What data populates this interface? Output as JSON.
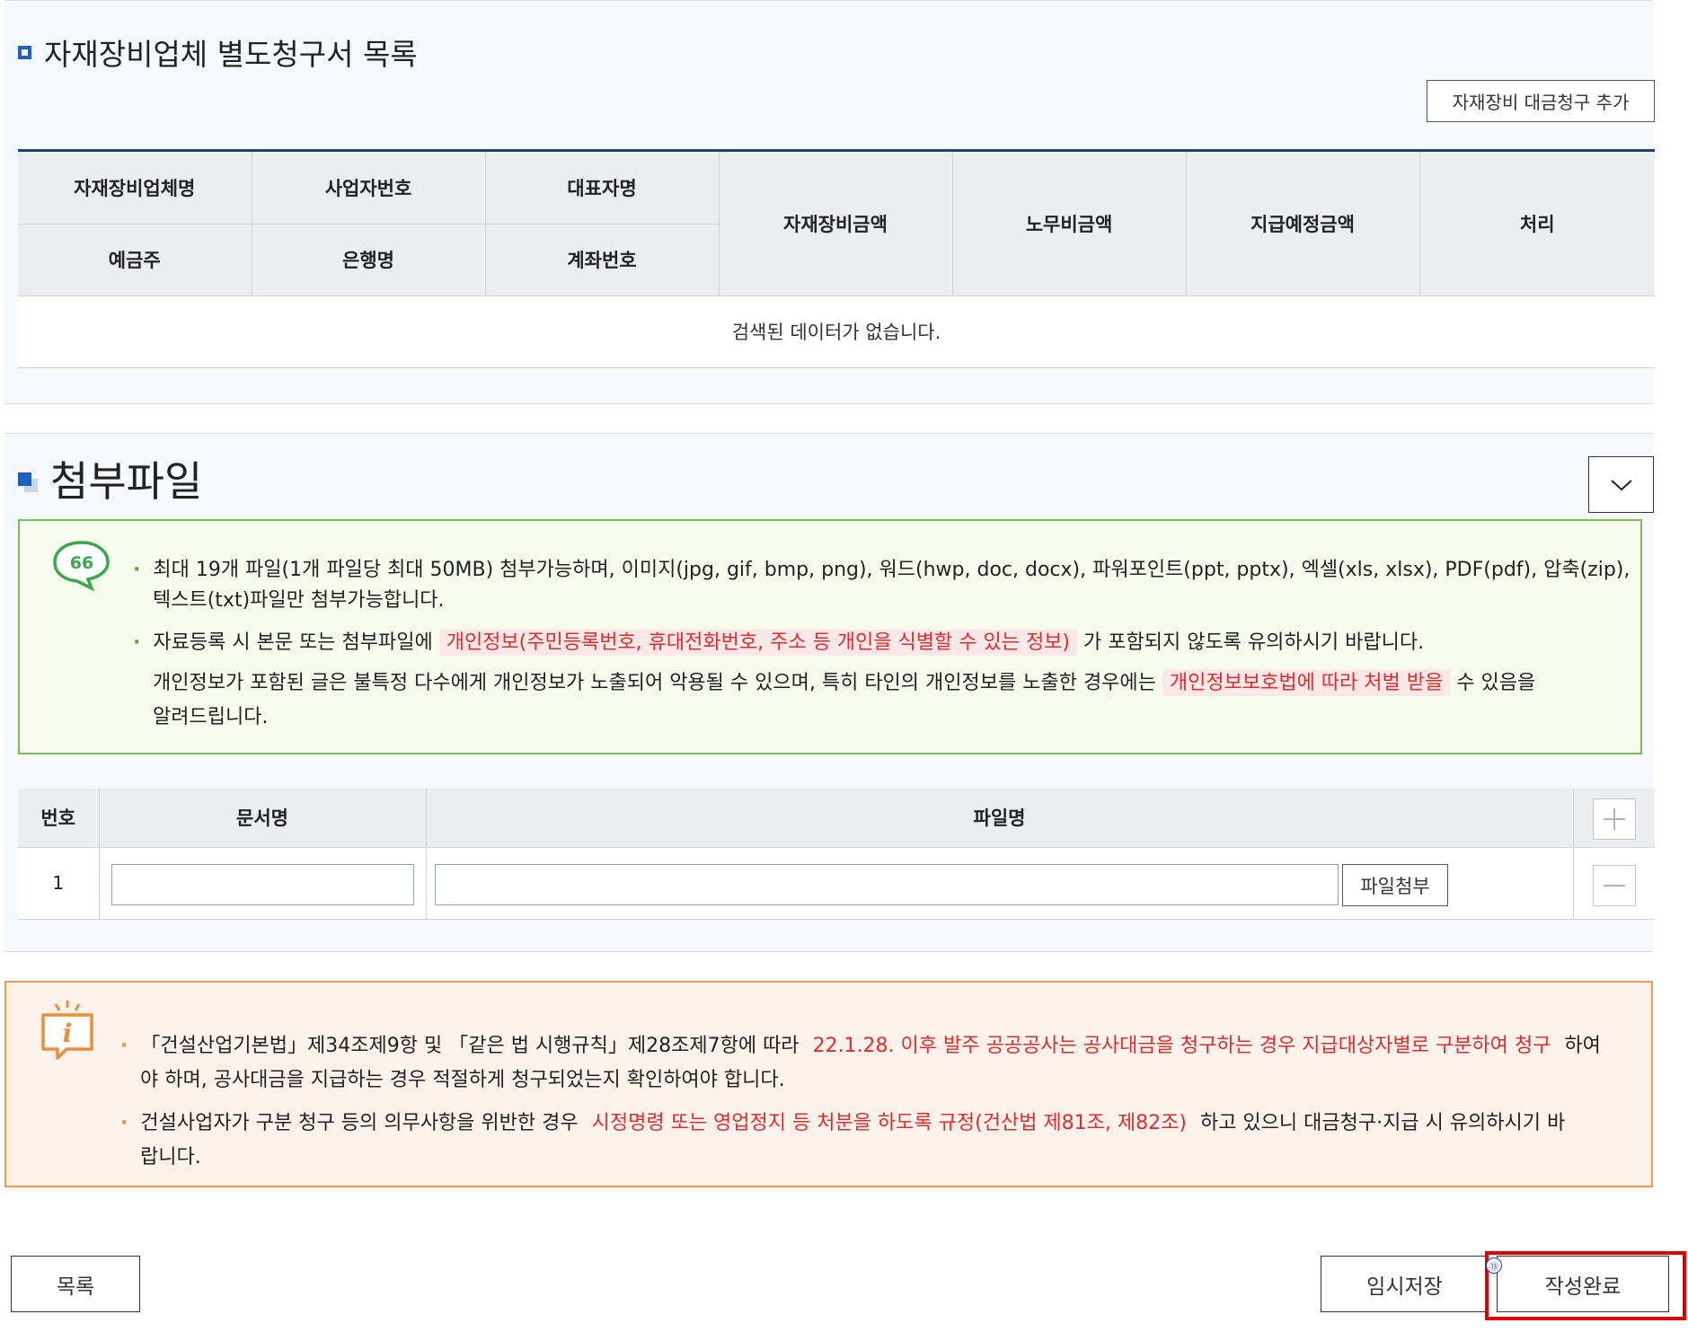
{
  "materials": {
    "title": "자재장비업체 별도청구서 목록",
    "add_button": "자재장비 대금청구 추가",
    "headers": {
      "company": "자재장비업체명",
      "biz_no": "사업자번호",
      "ceo": "대표자명",
      "depositor": "예금주",
      "bank": "은행명",
      "account": "계좌번호",
      "material_amount": "자재장비금액",
      "labor_amount": "노무비금액",
      "planned_amount": "지급예정금액",
      "action": "처리"
    },
    "empty_message": "검색된 데이터가 없습니다."
  },
  "attachments": {
    "title": "첨부파일",
    "notice": {
      "line1": "최대 19개 파일(1개 파일당 최대 50MB) 첨부가능하며, 이미지(jpg, gif, bmp, png), 워드(hwp, doc, docx), 파워포인트(ppt, pptx), 엑셀(xls, xlsx), PDF(pdf), 압축(zip),",
      "line1b": "텍스트(txt)파일만 첨부가능합니다.",
      "line2_pre": "자료등록 시 본문 또는 첨부파일에",
      "line2_red": "개인정보(주민등록번호, 휴대전화번호, 주소 등 개인을 식별할 수 있는 정보)",
      "line2_post": "가 포함되지 않도록 유의하시기 바랍니다.",
      "line3_pre": "개인정보가 포함된 글은 불특정 다수에게 개인정보가 노출되어 악용될 수 있으며, 특히 타인의 개인정보를 노출한 경우에는",
      "line3_red": "개인정보보호법에 따라 처벌 받을",
      "line3_post": "수 있음을",
      "line4": "알려드립니다."
    },
    "headers": {
      "no": "번호",
      "doc_name": "문서명",
      "file_name": "파일명"
    },
    "rows": [
      {
        "no": "1",
        "doc_name": "",
        "file_name": ""
      }
    ],
    "attach_button": "파일첨부"
  },
  "legal_notice": {
    "line1_pre": "「건설산업기본법」제34조제9항 및 「같은 법 시행규칙」제28조제7항에 따라",
    "line1_red": "22.1.28. 이후 발주 공공공사는 공사대금을 청구하는 경우 지급대상자별로 구분하여 청구",
    "line1_post": "하여",
    "line1b": "야 하며, 공사대금을 지급하는 경우 적절하게 청구되었는지 확인하여야 합니다.",
    "line2_pre": "건설사업자가 구분 청구 등의 의무사항을 위반한 경우",
    "line2_red": "시정명령 또는 영업정지 등 처분을 하도록 규정(건산법 제81조, 제82조)",
    "line2_post": "하고 있으니 대금청구·지급 시 유의하시기 바",
    "line2b": "랍니다."
  },
  "footer": {
    "list_button": "목록",
    "temp_save_button": "임시저장",
    "complete_button": "작성완료",
    "step_marker": "⑬"
  },
  "colors": {
    "accent_blue": "#1f5fbf",
    "notice_green": "#7bbf5a",
    "notice_orange": "#ee9a55",
    "highlight_red": "#e02c2c",
    "callout_red": "#e00000"
  },
  "icons": [
    "square-bullet-icon",
    "chevron-down-icon",
    "quote-bubble-icon",
    "info-bubble-icon",
    "plus-icon",
    "minus-icon"
  ]
}
